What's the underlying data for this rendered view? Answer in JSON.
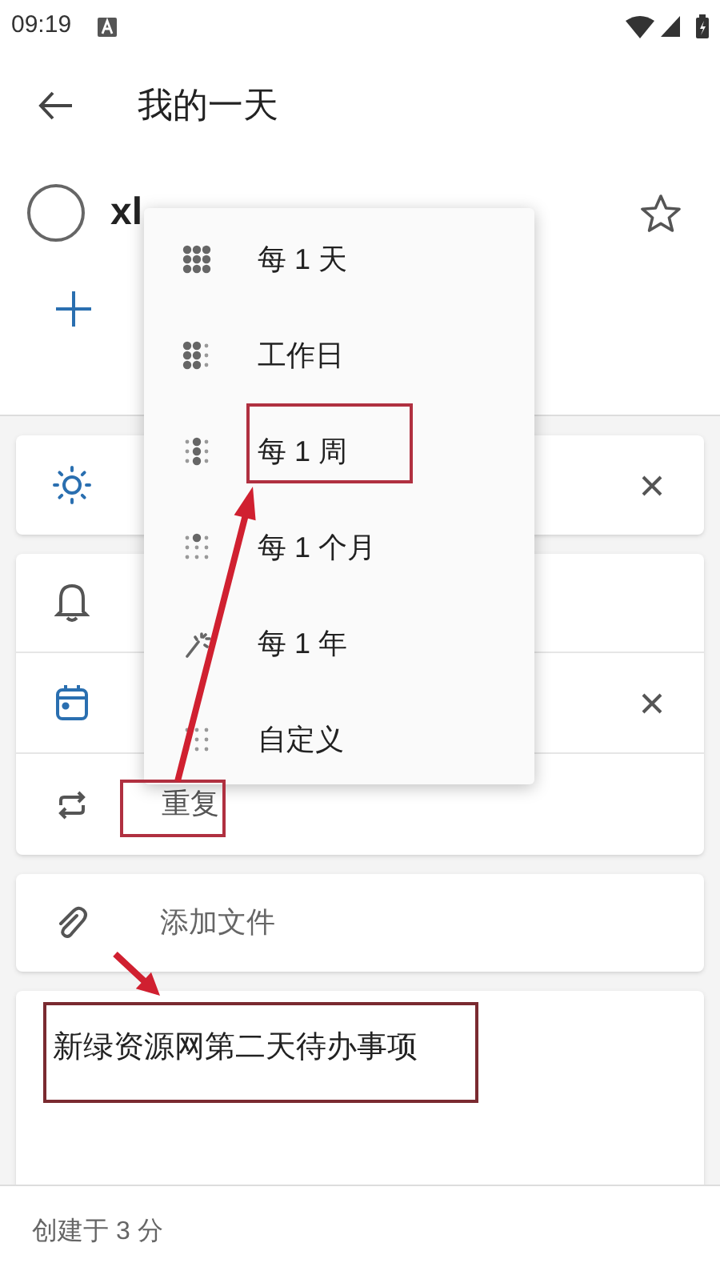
{
  "status_bar": {
    "time": "09:19"
  },
  "header": {
    "title": "我的一天"
  },
  "task": {
    "title": "xl",
    "completed": false,
    "important": false
  },
  "menu": {
    "items": [
      {
        "kind": "daily",
        "label": "每 1 天"
      },
      {
        "kind": "weekdays",
        "label": "工作日"
      },
      {
        "kind": "weekly",
        "label": "每 1 周"
      },
      {
        "kind": "monthly",
        "label": "每 1 个月"
      },
      {
        "kind": "yearly",
        "label": "每 1 年"
      },
      {
        "kind": "custom",
        "label": "自定义"
      }
    ]
  },
  "repeat": {
    "label": "重复"
  },
  "attach": {
    "label": "添加文件"
  },
  "note": {
    "text": "新绿资源网第二天待办事项"
  },
  "footer": {
    "text": "创建于 3 分"
  }
}
